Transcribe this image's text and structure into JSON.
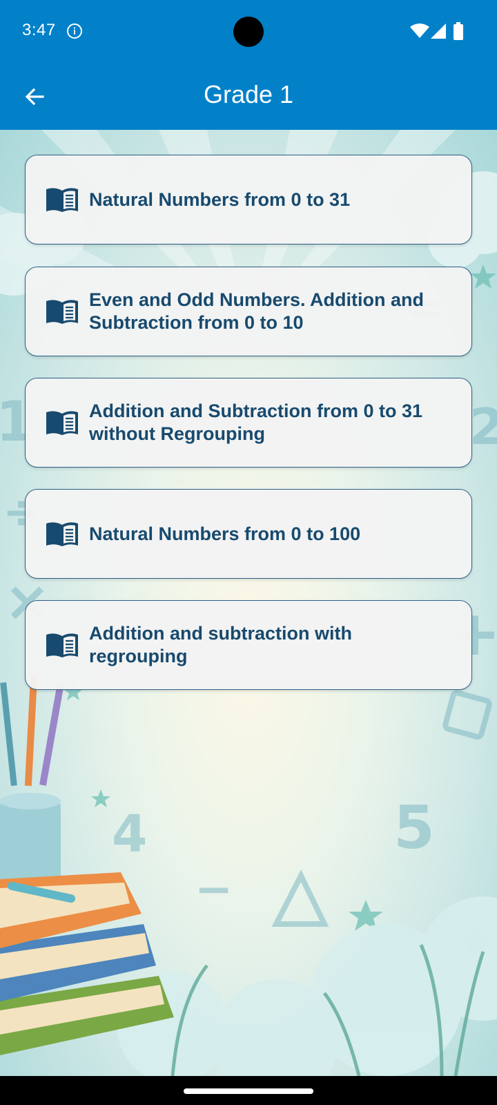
{
  "status_bar": {
    "time": "3:47",
    "icons": [
      "info-icon",
      "wifi-icon",
      "signal-icon",
      "battery-icon"
    ]
  },
  "app_bar": {
    "title": "Grade 1",
    "back_icon": "arrow-left-icon",
    "color": "#0281c9"
  },
  "topics": [
    {
      "label": "Natural Numbers from 0 to 31",
      "icon": "book-icon"
    },
    {
      "label": "Even and Odd Numbers. Addition and Subtraction from 0 to 10",
      "icon": "book-icon"
    },
    {
      "label": "Addition and Subtraction from 0 to 31 without Regrouping",
      "icon": "book-icon"
    },
    {
      "label": "Natural Numbers from 0 to 100",
      "icon": "book-icon"
    },
    {
      "label": "Addition and subtraction with regrouping",
      "icon": "book-icon"
    }
  ],
  "colors": {
    "accent": "#0281c9",
    "card_border": "#2a5f86",
    "card_text": "#174a6e",
    "card_bg": "#f3f3f3"
  }
}
